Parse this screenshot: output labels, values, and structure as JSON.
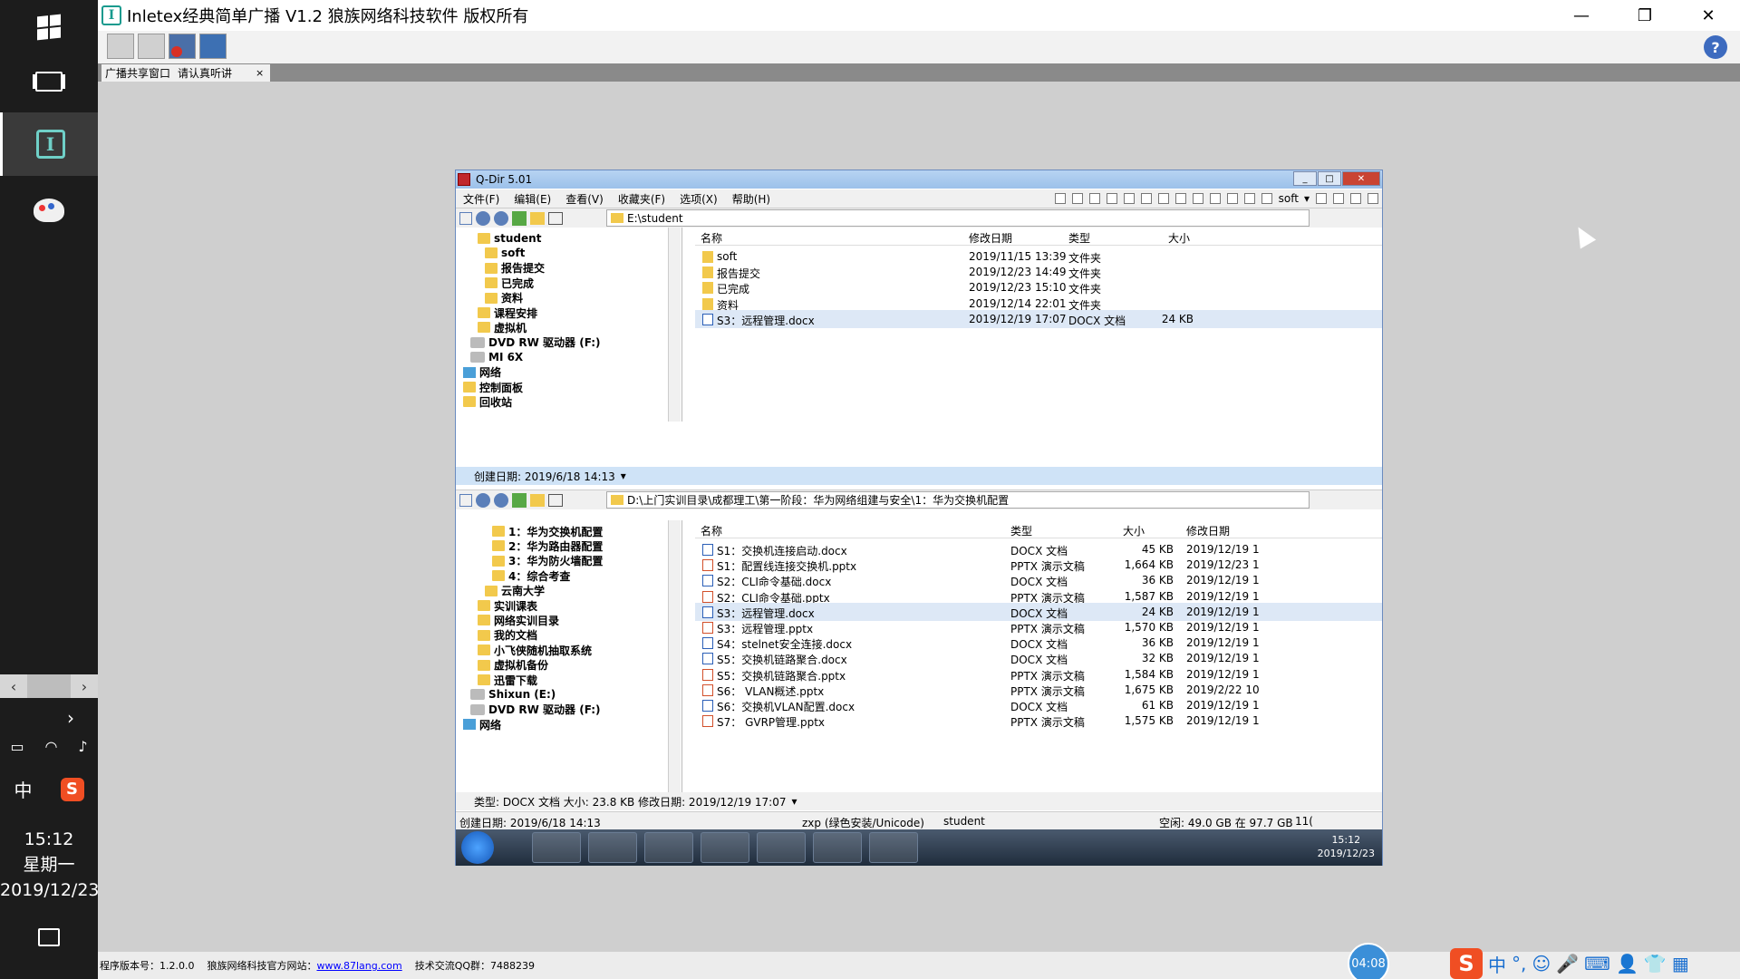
{
  "os": {
    "clock_time": "15:12",
    "clock_day": "星期一",
    "clock_date": "2019/12/23",
    "ime_label": "中",
    "sogou_label": "S"
  },
  "app": {
    "title": "Inletex经典简单广播 V1.2 狼族网络科技软件 版权所有",
    "tab_label_1": "广播共享窗口",
    "tab_label_2": "请认真听讲",
    "tab_close": "×",
    "help_label": "?",
    "status_version": "程序版本号：1.2.0.0",
    "status_site_label": "狼族网络科技官方网站：",
    "status_site_link": "www.87lang.com",
    "status_qq": "技术交流QQ群：7488239",
    "timer": "04:08",
    "ime_items": [
      "中",
      "°,",
      "☺",
      "🎤",
      "⌨",
      "👤",
      "👕",
      "▦"
    ]
  },
  "qdir": {
    "title": "Q-Dir 5.01",
    "menu": [
      "文件(F)",
      "编辑(E)",
      "查看(V)",
      "收藏夹(F)",
      "选项(X)",
      "帮助(H)"
    ],
    "toolbar_select": "soft",
    "top": {
      "address": "E:\\student",
      "tree": [
        {
          "label": "student",
          "indent": 2
        },
        {
          "label": "soft",
          "indent": 3
        },
        {
          "label": "报告提交",
          "indent": 3
        },
        {
          "label": "已完成",
          "indent": 3
        },
        {
          "label": "资料",
          "indent": 3
        },
        {
          "label": "课程安排",
          "indent": 2
        },
        {
          "label": "虚拟机",
          "indent": 2
        },
        {
          "label": "DVD RW 驱动器 (F:)",
          "indent": 1
        },
        {
          "label": "MI 6X",
          "indent": 1
        },
        {
          "label": "网络",
          "indent": 0
        },
        {
          "label": "控制面板",
          "indent": 0
        },
        {
          "label": "回收站",
          "indent": 0
        }
      ],
      "columns": [
        "名称",
        "修改日期",
        "类型",
        "大小"
      ],
      "rows": [
        {
          "name": "soft",
          "date": "2019/11/15 13:39",
          "type": "文件夹",
          "size": "",
          "kind": "fd"
        },
        {
          "name": "报告提交",
          "date": "2019/12/23 14:49",
          "type": "文件夹",
          "size": "",
          "kind": "fd"
        },
        {
          "name": "已完成",
          "date": "2019/12/23 15:10",
          "type": "文件夹",
          "size": "",
          "kind": "fd"
        },
        {
          "name": "资料",
          "date": "2019/12/14 22:01",
          "type": "文件夹",
          "size": "",
          "kind": "fd"
        },
        {
          "name": "S3：远程管理.docx",
          "date": "2019/12/19 17:07",
          "type": "DOCX 文档",
          "size": "24 KB",
          "kind": "doc"
        }
      ],
      "status": "创建日期: 2019/6/18 14:13"
    },
    "bottom": {
      "address": "D:\\上门实训目录\\成都理工\\第一阶段：华为网络组建与安全\\1：华为交换机配置",
      "tree": [
        {
          "label": "1：华为交换机配置",
          "indent": 4
        },
        {
          "label": "2：华为路由器配置",
          "indent": 4
        },
        {
          "label": "3：华为防火墙配置",
          "indent": 4
        },
        {
          "label": "4：综合考查",
          "indent": 4
        },
        {
          "label": "云南大学",
          "indent": 3
        },
        {
          "label": "实训课表",
          "indent": 2
        },
        {
          "label": "网络实训目录",
          "indent": 2
        },
        {
          "label": "我的文档",
          "indent": 2
        },
        {
          "label": "小飞侠随机抽取系统",
          "indent": 2
        },
        {
          "label": "虚拟机备份",
          "indent": 2
        },
        {
          "label": "迅雷下载",
          "indent": 2
        },
        {
          "label": "Shixun (E:)",
          "indent": 1
        },
        {
          "label": "DVD RW 驱动器 (F:)",
          "indent": 1
        },
        {
          "label": "网络",
          "indent": 0
        }
      ],
      "columns": [
        "名称",
        "类型",
        "大小",
        "修改日期"
      ],
      "rows": [
        {
          "name": "S1：交换机连接启动.docx",
          "type": "DOCX 文档",
          "size": "45 KB",
          "date": "2019/12/19 1",
          "kind": "doc"
        },
        {
          "name": "S1：配置线连接交换机.pptx",
          "type": "PPTX 演示文稿",
          "size": "1,664 KB",
          "date": "2019/12/23 1",
          "kind": "ppt"
        },
        {
          "name": "S2：CLI命令基础.docx",
          "type": "DOCX 文档",
          "size": "36 KB",
          "date": "2019/12/19 1",
          "kind": "doc"
        },
        {
          "name": "S2：CLI命令基础.pptx",
          "type": "PPTX 演示文稿",
          "size": "1,587 KB",
          "date": "2019/12/19 1",
          "kind": "ppt"
        },
        {
          "name": "S3：远程管理.docx",
          "type": "DOCX 文档",
          "size": "24 KB",
          "date": "2019/12/19 1",
          "kind": "doc"
        },
        {
          "name": "S3：远程管理.pptx",
          "type": "PPTX 演示文稿",
          "size": "1,570 KB",
          "date": "2019/12/19 1",
          "kind": "ppt"
        },
        {
          "name": "S4：stelnet安全连接.docx",
          "type": "DOCX 文档",
          "size": "36 KB",
          "date": "2019/12/19 1",
          "kind": "doc"
        },
        {
          "name": "S5：交换机链路聚合.docx",
          "type": "DOCX 文档",
          "size": "32 KB",
          "date": "2019/12/19 1",
          "kind": "doc"
        },
        {
          "name": "S5：交换机链路聚合.pptx",
          "type": "PPTX 演示文稿",
          "size": "1,584 KB",
          "date": "2019/12/19 1",
          "kind": "ppt"
        },
        {
          "name": "S6： VLAN概述.pptx",
          "type": "PPTX 演示文稿",
          "size": "1,675 KB",
          "date": "2019/2/22 10",
          "kind": "ppt"
        },
        {
          "name": "S6：交换机VLAN配置.docx",
          "type": "DOCX 文档",
          "size": "61 KB",
          "date": "2019/12/19 1",
          "kind": "doc"
        },
        {
          "name": "S7： GVRP管理.pptx",
          "type": "PPTX 演示文稿",
          "size": "1,575 KB",
          "date": "2019/12/19 1",
          "kind": "ppt"
        }
      ],
      "status": "类型: DOCX 文档 大小: 23.8 KB 修改日期: 2019/12/19 17:07"
    },
    "status": {
      "created": "创建日期: 2019/6/18 14:13",
      "encoding": "zxp (绿色安装/Unicode)",
      "folder": "student",
      "space": "空闲: 49.0 GB 在 97.7 GB",
      "extra": "11("
    },
    "taskbar": {
      "time": "15:12",
      "date": "2019/12/23"
    }
  }
}
